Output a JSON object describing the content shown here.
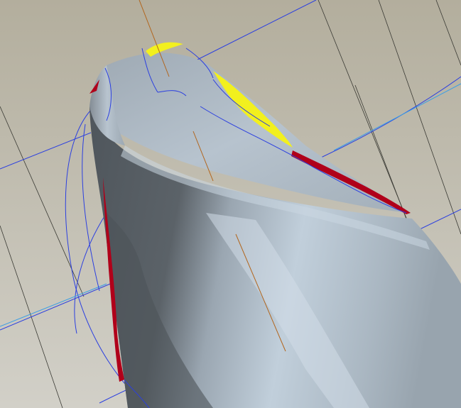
{
  "viewport": {
    "colors": {
      "background_top": "#b3ae9d",
      "background_bottom": "#d2d0c8",
      "grid_line": "#3a3a34",
      "curve_blue": "#2b3fe0",
      "light_blue_line": "#3a9ee6",
      "surface_light": "#c1cfdb",
      "surface_mid": "#9aa6b1",
      "surface_dark": "#4f565c",
      "edge_red": "#b0001a",
      "highlight_yellow": "#f2f01e",
      "axis_orange": "#b2651c"
    }
  }
}
